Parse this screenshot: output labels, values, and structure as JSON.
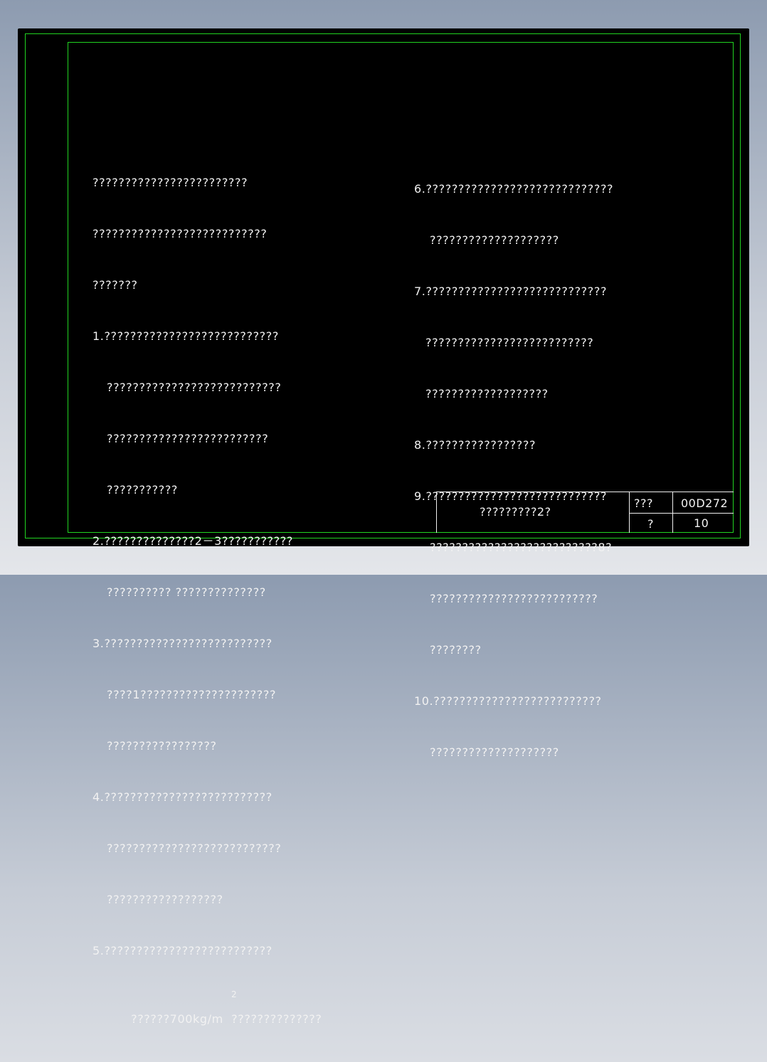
{
  "drawing": {
    "notes_left": [
      {
        "text": "????????????????????????",
        "indent": 0
      },
      {
        "text": "???????????????????????????",
        "indent": 0
      },
      {
        "text": "???????",
        "indent": 0
      },
      {
        "text": "1.???????????????????????????",
        "indent": 0
      },
      {
        "text": "???????????????????????????",
        "indent": 1
      },
      {
        "text": "?????????????????????????",
        "indent": 1
      },
      {
        "text": "???????????",
        "indent": 1
      },
      {
        "text": "2.??????????????2－3???????????",
        "indent": 0
      },
      {
        "text": "?????????? ??????????????",
        "indent": 1
      },
      {
        "text": "3.??????????????????????????",
        "indent": 0
      },
      {
        "text": "????1?????????????????????",
        "indent": 1
      },
      {
        "text": "?????????????????",
        "indent": 1
      },
      {
        "text": "4.??????????????????????????",
        "indent": 0
      },
      {
        "text": "???????????????????????????",
        "indent": 1
      },
      {
        "text": "??????????????????",
        "indent": 1
      },
      {
        "text": "5.??????????????????????????",
        "indent": 0
      },
      {
        "text": "??????700kg/m  ??????????????",
        "indent": 1
      }
    ],
    "superscript": "2",
    "notes_right": [
      {
        "text": "6.?????????????????????????????",
        "indent": 0
      },
      {
        "text": "????????????????????",
        "indent": 3
      },
      {
        "text": "7.????????????????????????????",
        "indent": 0
      },
      {
        "text": "??????????????????????????",
        "indent": 2
      },
      {
        "text": "???????????????????",
        "indent": 2
      },
      {
        "text": "8.?????????????????",
        "indent": 0
      },
      {
        "text": "9.????????????????????????????",
        "indent": 0
      },
      {
        "text": "??????????????????????????8?",
        "indent": 3
      },
      {
        "text": "??????????????????????????",
        "indent": 3
      },
      {
        "text": "????????",
        "indent": 3
      },
      {
        "text": "10.??????????????????????????",
        "indent": 0
      },
      {
        "text": "????????????????????",
        "indent": 3
      }
    ],
    "title_block": {
      "title": "?????????2?",
      "label_top": "???",
      "value_top": "00D272",
      "label_bottom": "?",
      "value_bottom": "10"
    }
  }
}
